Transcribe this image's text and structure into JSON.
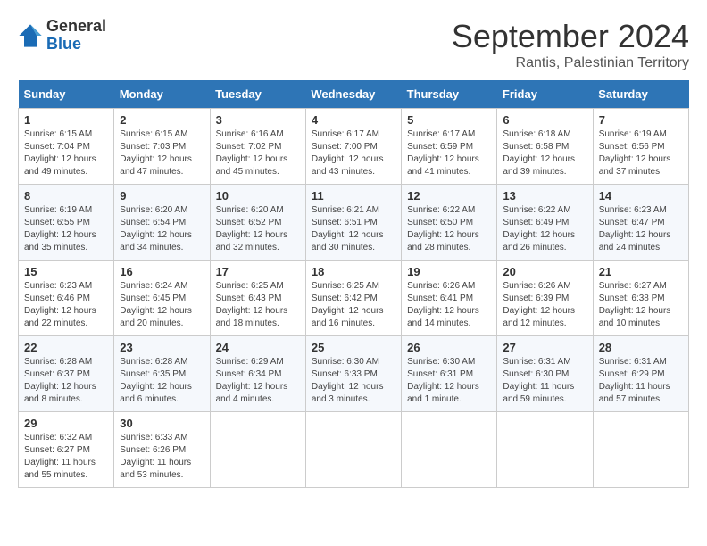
{
  "logo": {
    "line1": "General",
    "line2": "Blue"
  },
  "title": "September 2024",
  "subtitle": "Rantis, Palestinian Territory",
  "days_of_week": [
    "Sunday",
    "Monday",
    "Tuesday",
    "Wednesday",
    "Thursday",
    "Friday",
    "Saturday"
  ],
  "weeks": [
    [
      {
        "day": "1",
        "info": "Sunrise: 6:15 AM\nSunset: 7:04 PM\nDaylight: 12 hours\nand 49 minutes."
      },
      {
        "day": "2",
        "info": "Sunrise: 6:15 AM\nSunset: 7:03 PM\nDaylight: 12 hours\nand 47 minutes."
      },
      {
        "day": "3",
        "info": "Sunrise: 6:16 AM\nSunset: 7:02 PM\nDaylight: 12 hours\nand 45 minutes."
      },
      {
        "day": "4",
        "info": "Sunrise: 6:17 AM\nSunset: 7:00 PM\nDaylight: 12 hours\nand 43 minutes."
      },
      {
        "day": "5",
        "info": "Sunrise: 6:17 AM\nSunset: 6:59 PM\nDaylight: 12 hours\nand 41 minutes."
      },
      {
        "day": "6",
        "info": "Sunrise: 6:18 AM\nSunset: 6:58 PM\nDaylight: 12 hours\nand 39 minutes."
      },
      {
        "day": "7",
        "info": "Sunrise: 6:19 AM\nSunset: 6:56 PM\nDaylight: 12 hours\nand 37 minutes."
      }
    ],
    [
      {
        "day": "8",
        "info": "Sunrise: 6:19 AM\nSunset: 6:55 PM\nDaylight: 12 hours\nand 35 minutes."
      },
      {
        "day": "9",
        "info": "Sunrise: 6:20 AM\nSunset: 6:54 PM\nDaylight: 12 hours\nand 34 minutes."
      },
      {
        "day": "10",
        "info": "Sunrise: 6:20 AM\nSunset: 6:52 PM\nDaylight: 12 hours\nand 32 minutes."
      },
      {
        "day": "11",
        "info": "Sunrise: 6:21 AM\nSunset: 6:51 PM\nDaylight: 12 hours\nand 30 minutes."
      },
      {
        "day": "12",
        "info": "Sunrise: 6:22 AM\nSunset: 6:50 PM\nDaylight: 12 hours\nand 28 minutes."
      },
      {
        "day": "13",
        "info": "Sunrise: 6:22 AM\nSunset: 6:49 PM\nDaylight: 12 hours\nand 26 minutes."
      },
      {
        "day": "14",
        "info": "Sunrise: 6:23 AM\nSunset: 6:47 PM\nDaylight: 12 hours\nand 24 minutes."
      }
    ],
    [
      {
        "day": "15",
        "info": "Sunrise: 6:23 AM\nSunset: 6:46 PM\nDaylight: 12 hours\nand 22 minutes."
      },
      {
        "day": "16",
        "info": "Sunrise: 6:24 AM\nSunset: 6:45 PM\nDaylight: 12 hours\nand 20 minutes."
      },
      {
        "day": "17",
        "info": "Sunrise: 6:25 AM\nSunset: 6:43 PM\nDaylight: 12 hours\nand 18 minutes."
      },
      {
        "day": "18",
        "info": "Sunrise: 6:25 AM\nSunset: 6:42 PM\nDaylight: 12 hours\nand 16 minutes."
      },
      {
        "day": "19",
        "info": "Sunrise: 6:26 AM\nSunset: 6:41 PM\nDaylight: 12 hours\nand 14 minutes."
      },
      {
        "day": "20",
        "info": "Sunrise: 6:26 AM\nSunset: 6:39 PM\nDaylight: 12 hours\nand 12 minutes."
      },
      {
        "day": "21",
        "info": "Sunrise: 6:27 AM\nSunset: 6:38 PM\nDaylight: 12 hours\nand 10 minutes."
      }
    ],
    [
      {
        "day": "22",
        "info": "Sunrise: 6:28 AM\nSunset: 6:37 PM\nDaylight: 12 hours\nand 8 minutes."
      },
      {
        "day": "23",
        "info": "Sunrise: 6:28 AM\nSunset: 6:35 PM\nDaylight: 12 hours\nand 6 minutes."
      },
      {
        "day": "24",
        "info": "Sunrise: 6:29 AM\nSunset: 6:34 PM\nDaylight: 12 hours\nand 4 minutes."
      },
      {
        "day": "25",
        "info": "Sunrise: 6:30 AM\nSunset: 6:33 PM\nDaylight: 12 hours\nand 3 minutes."
      },
      {
        "day": "26",
        "info": "Sunrise: 6:30 AM\nSunset: 6:31 PM\nDaylight: 12 hours\nand 1 minute."
      },
      {
        "day": "27",
        "info": "Sunrise: 6:31 AM\nSunset: 6:30 PM\nDaylight: 11 hours\nand 59 minutes."
      },
      {
        "day": "28",
        "info": "Sunrise: 6:31 AM\nSunset: 6:29 PM\nDaylight: 11 hours\nand 57 minutes."
      }
    ],
    [
      {
        "day": "29",
        "info": "Sunrise: 6:32 AM\nSunset: 6:27 PM\nDaylight: 11 hours\nand 55 minutes."
      },
      {
        "day": "30",
        "info": "Sunrise: 6:33 AM\nSunset: 6:26 PM\nDaylight: 11 hours\nand 53 minutes."
      },
      {
        "day": "",
        "info": ""
      },
      {
        "day": "",
        "info": ""
      },
      {
        "day": "",
        "info": ""
      },
      {
        "day": "",
        "info": ""
      },
      {
        "day": "",
        "info": ""
      }
    ]
  ]
}
